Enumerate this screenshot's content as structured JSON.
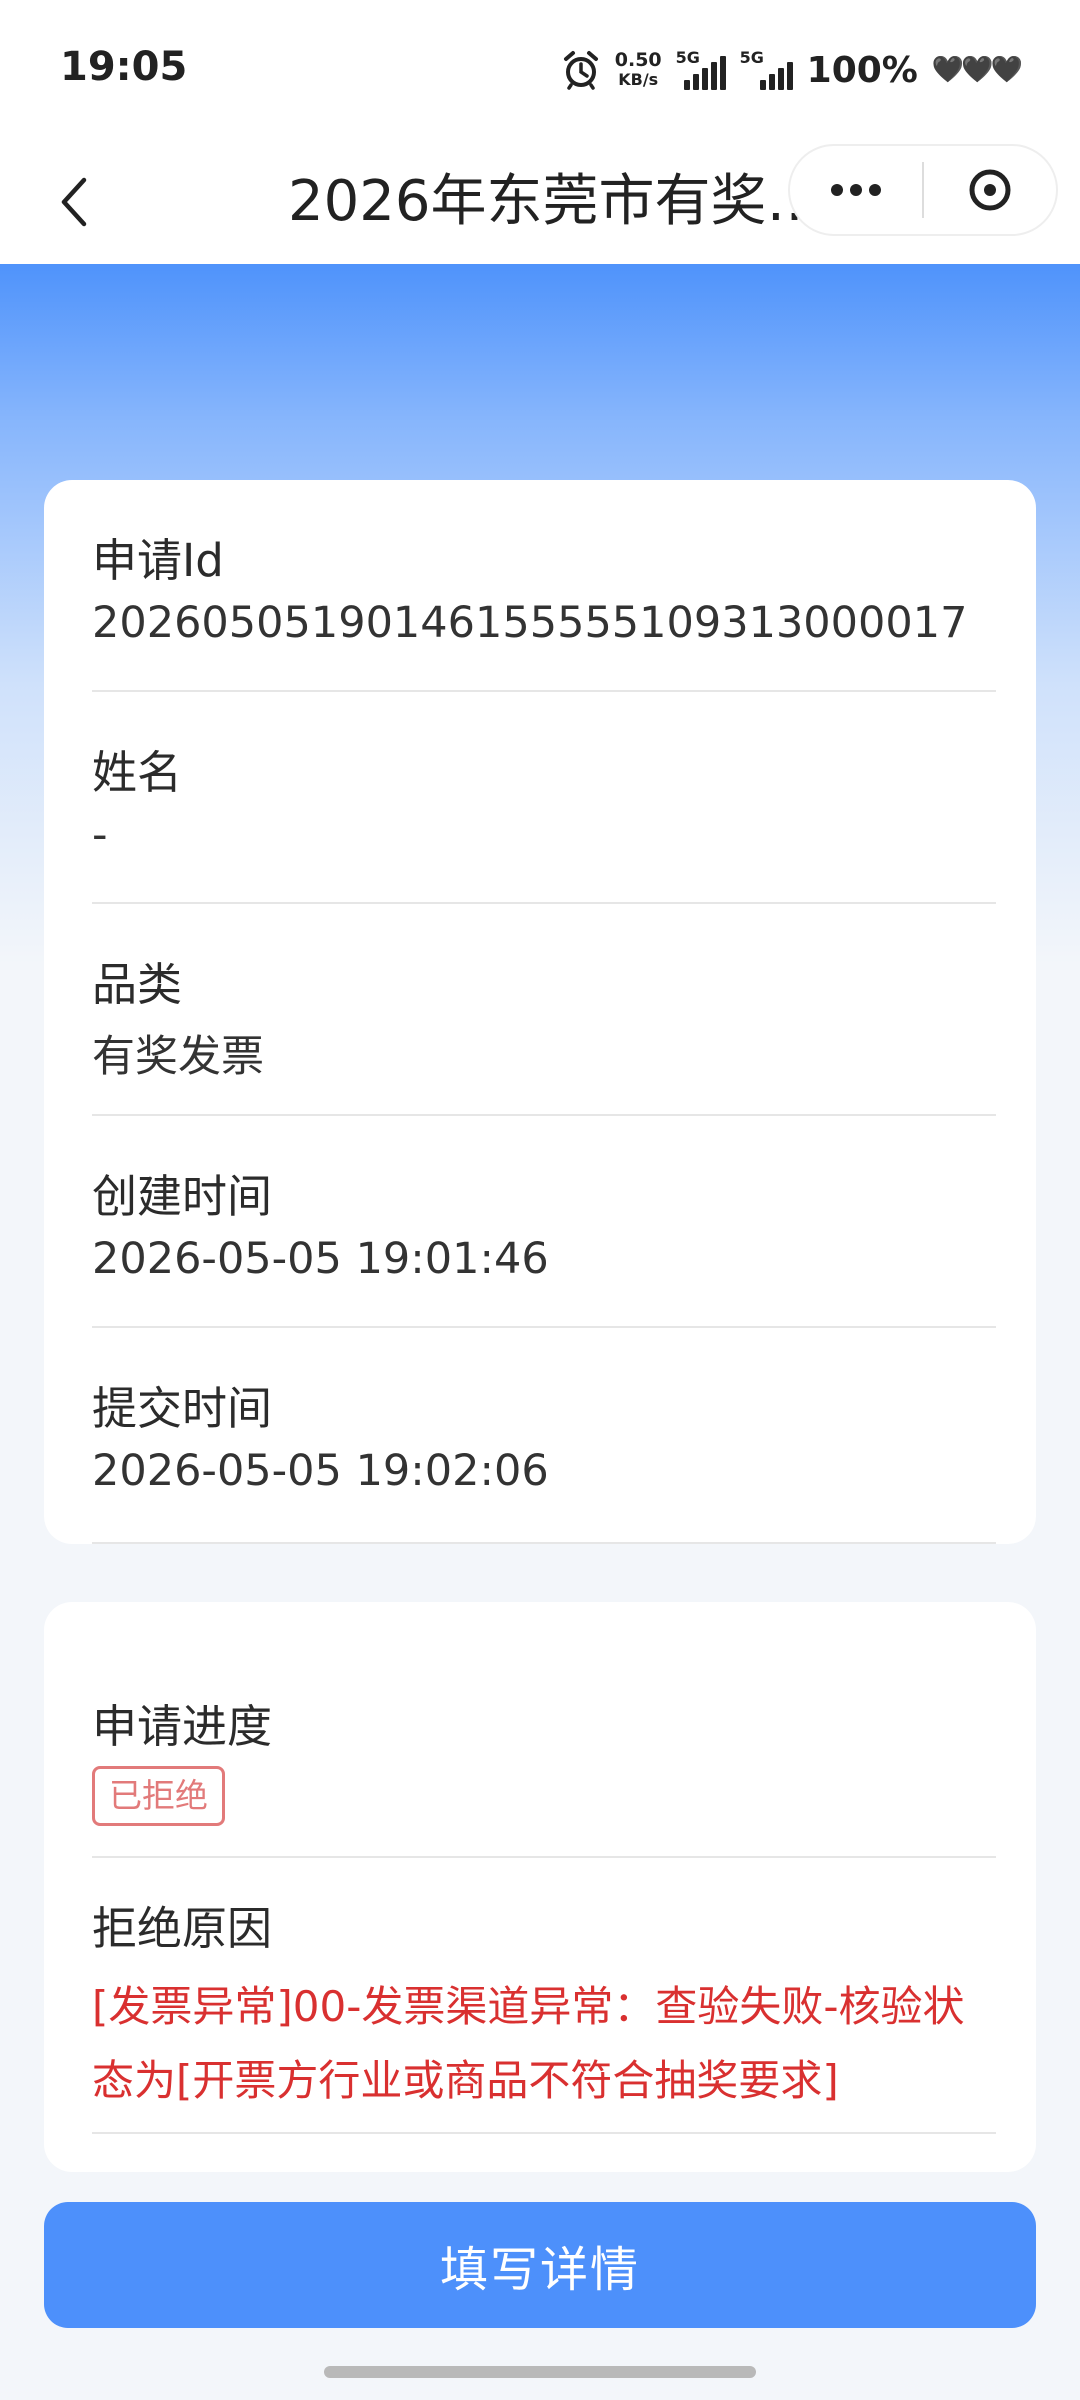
{
  "status_bar": {
    "time": "19:05",
    "net_speed_value": "0.50",
    "net_speed_unit": "KB/s",
    "signal_1_label": "5G",
    "signal_2_label": "5G",
    "battery": "100%",
    "hearts": "🖤🖤🖤"
  },
  "nav": {
    "title": "2026年东莞市有奖…",
    "icons": {
      "back": "chevron-left-icon",
      "more": "more-dots-icon",
      "close": "close-circle-icon"
    }
  },
  "info_card": {
    "fields": [
      {
        "label": "申请Id",
        "value": "20260505190146155555109313000017"
      },
      {
        "label": "姓名",
        "value": "-"
      },
      {
        "label": "品类",
        "value": "有奖发票"
      },
      {
        "label": "创建时间",
        "value": "2026-05-05 19:01:46"
      },
      {
        "label": "提交时间",
        "value": "2026-05-05 19:02:06"
      }
    ]
  },
  "progress_card": {
    "progress_label": "申请进度",
    "progress_status": "已拒绝",
    "reason_label": "拒绝原因",
    "reason_text": "[发票异常]00-发票渠道异常：查验失败-核验状态为[开票方行业或商品不符合抽奖要求]"
  },
  "actions": {
    "fill_details_label": "填写详情"
  },
  "colors": {
    "primary": "#4d90fb",
    "error": "#d93030",
    "tag_border": "#e27a7a"
  }
}
